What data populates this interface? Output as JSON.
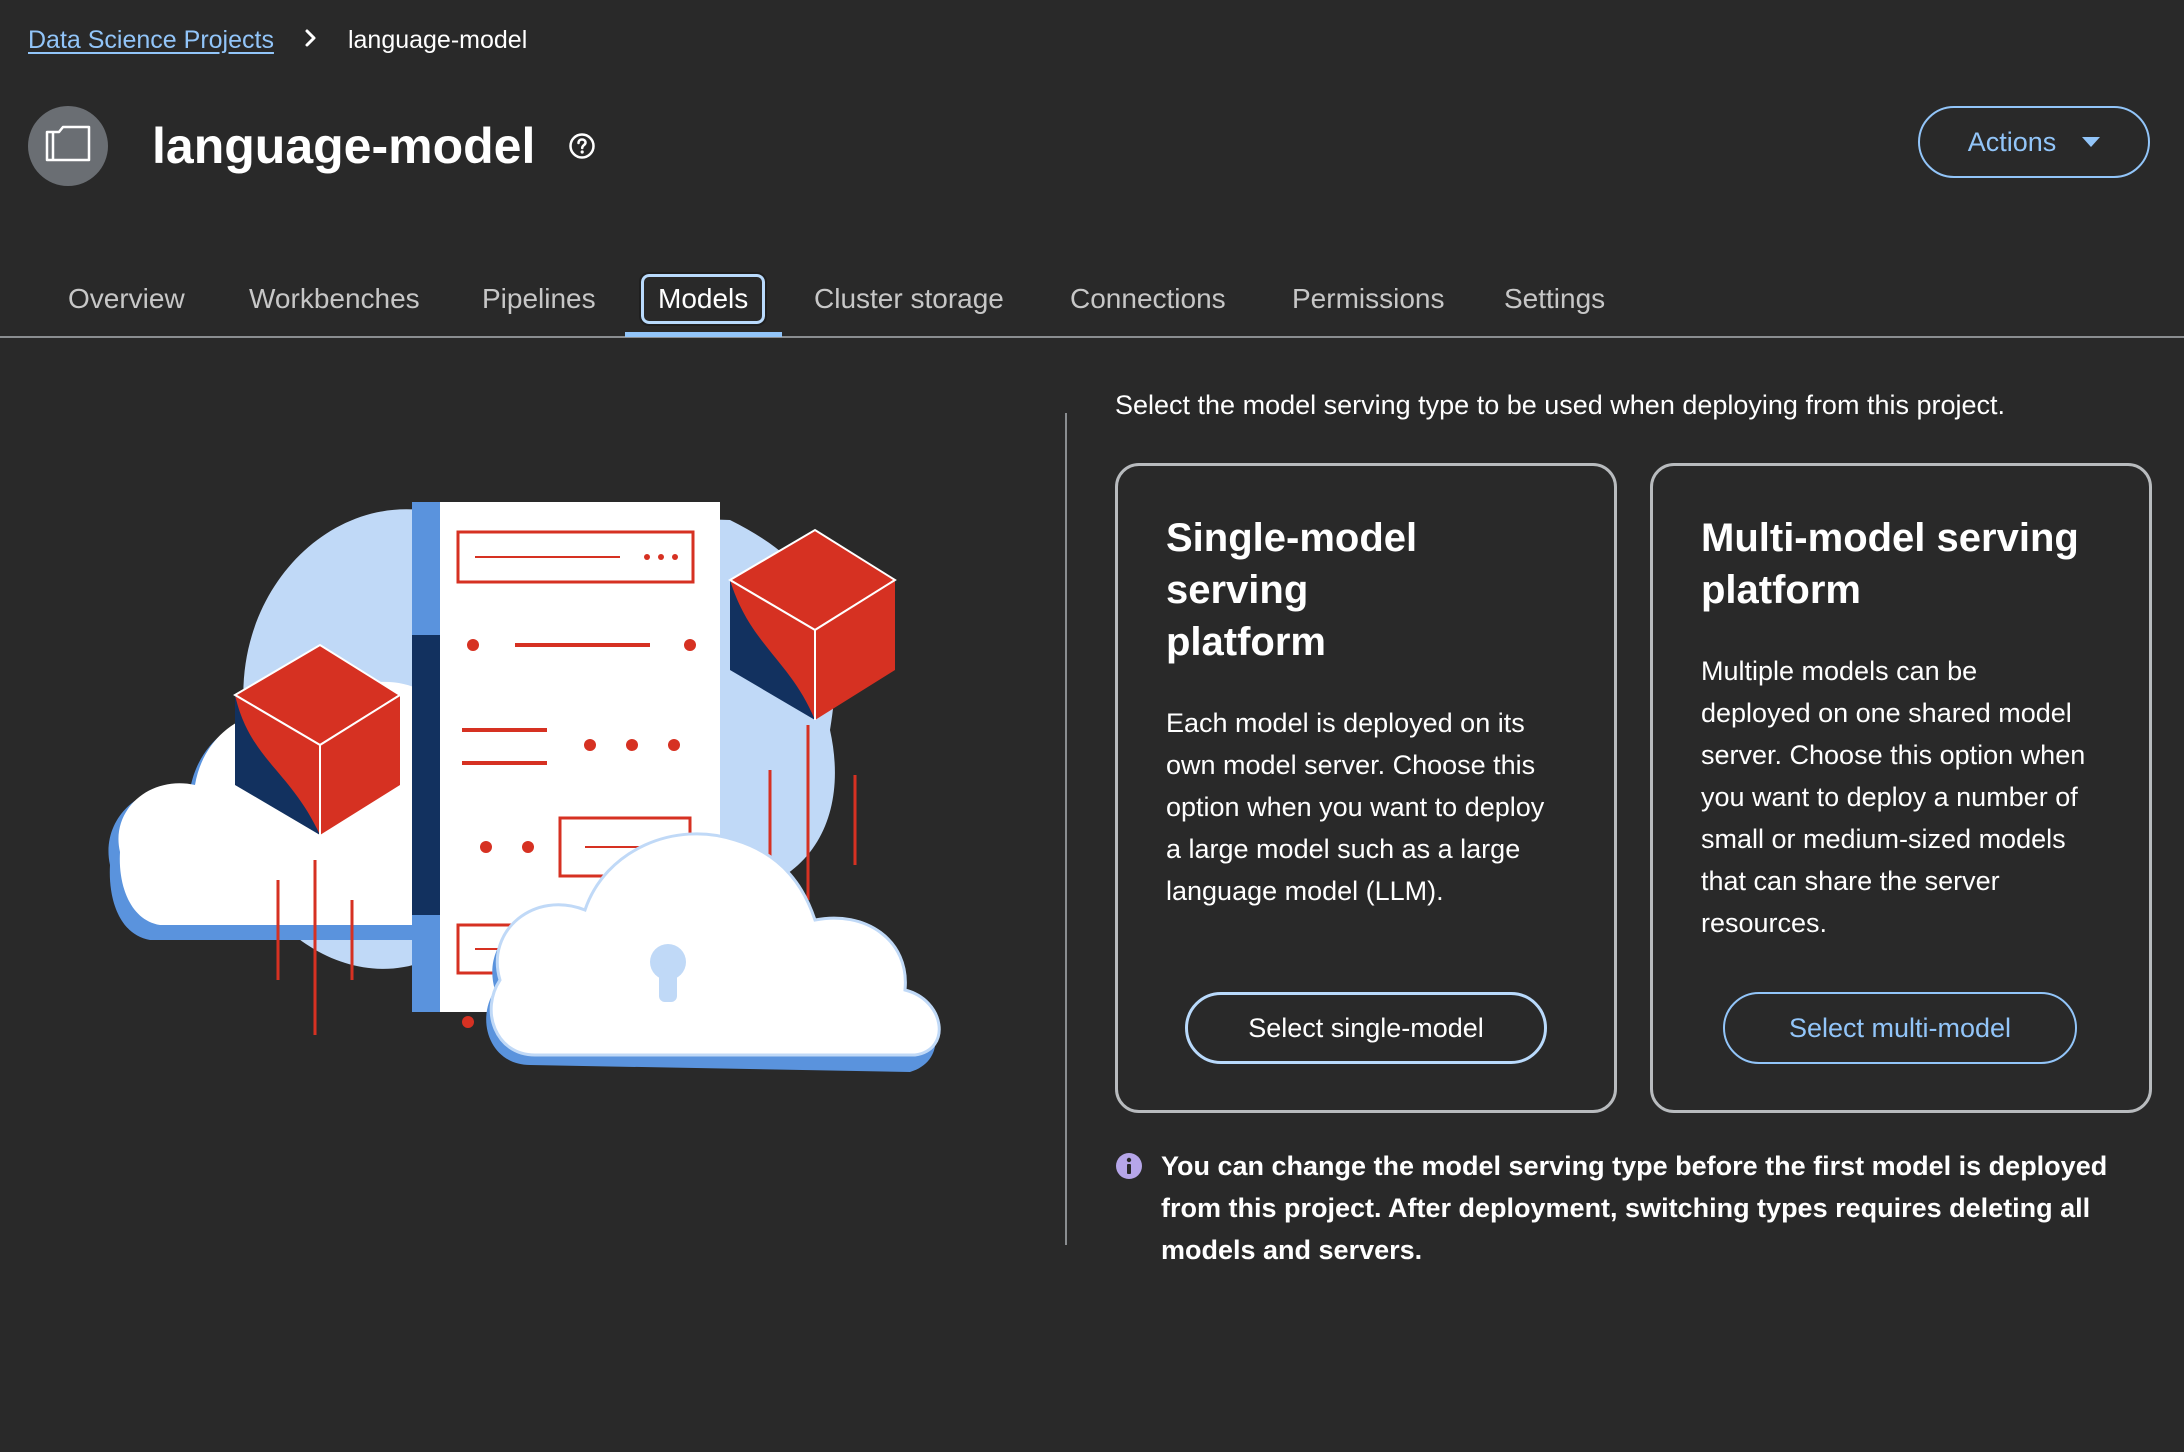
{
  "breadcrumb": {
    "parent": "Data Science Projects",
    "current": "language-model"
  },
  "header": {
    "title": "language-model",
    "actions_label": "Actions"
  },
  "tabs": [
    {
      "label": "Overview"
    },
    {
      "label": "Workbenches"
    },
    {
      "label": "Pipelines"
    },
    {
      "label": "Models",
      "active": true
    },
    {
      "label": "Cluster storage"
    },
    {
      "label": "Connections"
    },
    {
      "label": "Permissions"
    },
    {
      "label": "Settings"
    }
  ],
  "main": {
    "intro": "Select the model serving type to be used when deploying from this project.",
    "cards": [
      {
        "title_line1": "Single-model serving",
        "title_line2": "platform",
        "body_lines": [
          "Each model is deployed on its",
          "own model server. Choose this",
          "option when you want to deploy",
          "a large model such as a large",
          "language model (LLM)."
        ],
        "button": "Select single-model"
      },
      {
        "title_line1": "Multi-model serving",
        "title_line2": "platform",
        "body_lines": [
          "Multiple models can be",
          "deployed on one shared model",
          "server. Choose this option when",
          "you want to deploy a number of",
          "small or medium-sized models",
          "that can share the server",
          "resources."
        ],
        "button": "Select multi-model"
      }
    ],
    "info_lines": [
      "You can change the model serving type before the first model is deployed",
      "from this project. After deployment, switching types requires deleting all",
      "models and servers."
    ]
  },
  "colors": {
    "background": "#292929",
    "link": "#92c5f9",
    "info_icon": "#b6a6e9",
    "illustration_red": "#d63122",
    "illustration_navy": "#12315f",
    "illustration_light_blue": "#c0d9f7",
    "illustration_blue": "#5a93dd"
  },
  "icons": {
    "breadcrumb_separator": "chevron-right-icon",
    "project": "folder-icon",
    "help": "question-circle-icon",
    "actions": "caret-down-icon",
    "info": "info-circle-icon"
  }
}
